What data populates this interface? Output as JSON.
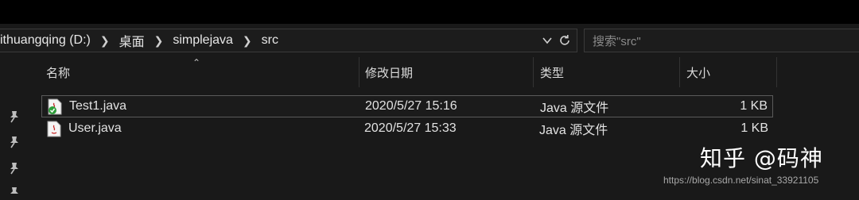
{
  "breadcrumb": {
    "items": [
      "ithuangqing (D:)",
      "桌面",
      "simplejava",
      "src"
    ]
  },
  "search": {
    "placeholder": "搜索\"src\""
  },
  "columns": {
    "name": "名称",
    "modified": "修改日期",
    "type": "类型",
    "size": "大小"
  },
  "files": [
    {
      "name": "Test1.java",
      "modified": "2020/5/27 15:16",
      "type": "Java 源文件",
      "size": "1 KB",
      "icon": "java-file-checked-icon",
      "selected": true
    },
    {
      "name": "User.java",
      "modified": "2020/5/27 15:33",
      "type": "Java 源文件",
      "size": "1 KB",
      "icon": "java-file-icon",
      "selected": false
    }
  ],
  "watermark": {
    "brand": "知乎 @码神",
    "url": "https://blog.csdn.net/sinat_33921105"
  },
  "colors": {
    "background": "#191919",
    "titlebar": "#000000",
    "text": "#e6e6e6",
    "check_green": "#2e9d3a",
    "java_red": "#c62828"
  }
}
